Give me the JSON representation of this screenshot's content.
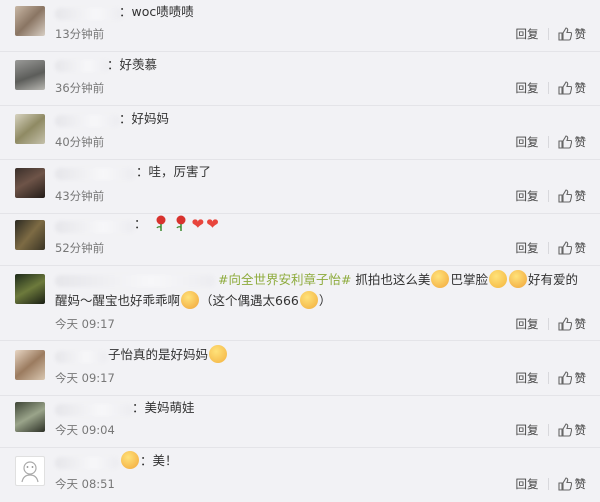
{
  "actions": {
    "reply": "回复",
    "like": "赞"
  },
  "comments": [
    {
      "text": "：woc啧啧啧",
      "time": "13分钟前"
    },
    {
      "text": "：好羡慕",
      "time": "36分钟前"
    },
    {
      "text": "：好妈妈",
      "time": "40分钟前"
    },
    {
      "text": "：哇，厉害了",
      "time": "43分钟前"
    },
    {
      "text": "：",
      "time": "52分钟前"
    },
    {
      "hashtag": "#向全世界安利章子怡#",
      "text_a": " 抓拍也这么美",
      "text_b": "巴掌脸",
      "text_c": "好有爱的醒妈～醒宝也好乖乖啊",
      "text_d": "（这个偶遇太666",
      "text_e": "）",
      "time": "今天 09:17"
    },
    {
      "text": "子怡真的是好妈妈",
      "time": "今天 09:17"
    },
    {
      "text": "：美妈萌娃",
      "time": "今天 09:04"
    },
    {
      "text": "：美！",
      "time": "今天 08:51"
    }
  ],
  "icons": {
    "like": "thumbs-up-icon",
    "rose": "rose-emoji",
    "heart": "heart-emoji"
  },
  "colors": {
    "hashtag": "#8dab3c",
    "background": "#f2f2f5"
  }
}
